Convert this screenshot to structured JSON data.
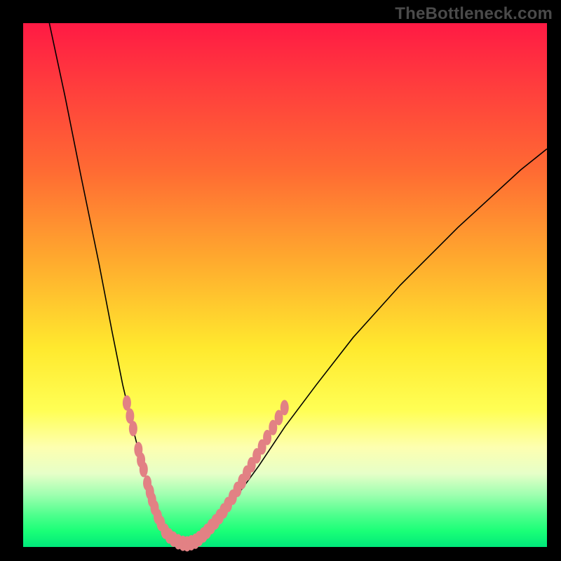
{
  "watermark": "TheBottleneck.com",
  "colors": {
    "frame": "#000000",
    "gradient_top": "#ff1a44",
    "gradient_bottom": "#00e87a",
    "curve": "#000000",
    "marker": "#e28184"
  },
  "chart_data": {
    "type": "line",
    "title": "",
    "xlabel": "",
    "ylabel": "",
    "xlim": [
      0,
      100
    ],
    "ylim": [
      0,
      100
    ],
    "annotations": [
      "TheBottleneck.com"
    ],
    "series": [
      {
        "name": "left-branch",
        "x": [
          5,
          8,
          11,
          14.5,
          17,
          19,
          21,
          22.5,
          23.7,
          24.5,
          25.5,
          27,
          29,
          31
        ],
        "y": [
          100,
          86,
          71,
          54,
          41,
          31,
          22.5,
          16.5,
          12,
          9,
          6,
          3,
          1,
          0
        ]
      },
      {
        "name": "right-branch",
        "x": [
          31,
          33,
          35.5,
          38,
          41,
          45,
          50,
          56,
          63,
          72,
          83,
          95,
          100
        ],
        "y": [
          0,
          1.2,
          3.2,
          6,
          10,
          15.5,
          23,
          31,
          40,
          50,
          61,
          72,
          76
        ]
      }
    ],
    "markers": {
      "name": "highlight-markers",
      "points": [
        {
          "x": 19.8,
          "y": 27.5
        },
        {
          "x": 20.4,
          "y": 25.0
        },
        {
          "x": 21.0,
          "y": 22.6
        },
        {
          "x": 22.0,
          "y": 18.6
        },
        {
          "x": 22.5,
          "y": 16.6
        },
        {
          "x": 23.0,
          "y": 14.8
        },
        {
          "x": 23.7,
          "y": 12.2
        },
        {
          "x": 24.2,
          "y": 10.5
        },
        {
          "x": 24.6,
          "y": 9.0
        },
        {
          "x": 25.1,
          "y": 7.5
        },
        {
          "x": 25.7,
          "y": 5.8
        },
        {
          "x": 26.3,
          "y": 4.5
        },
        {
          "x": 27.1,
          "y": 3.0
        },
        {
          "x": 27.9,
          "y": 2.1
        },
        {
          "x": 28.7,
          "y": 1.5
        },
        {
          "x": 29.6,
          "y": 1.0
        },
        {
          "x": 30.5,
          "y": 0.7
        },
        {
          "x": 31.3,
          "y": 0.6
        },
        {
          "x": 32.1,
          "y": 0.8
        },
        {
          "x": 32.9,
          "y": 1.1
        },
        {
          "x": 33.6,
          "y": 1.6
        },
        {
          "x": 34.4,
          "y": 2.3
        },
        {
          "x": 35.1,
          "y": 3.0
        },
        {
          "x": 35.9,
          "y": 3.9
        },
        {
          "x": 36.7,
          "y": 4.8
        },
        {
          "x": 37.5,
          "y": 5.8
        },
        {
          "x": 38.3,
          "y": 6.9
        },
        {
          "x": 39.1,
          "y": 8.1
        },
        {
          "x": 40.0,
          "y": 9.5
        },
        {
          "x": 40.9,
          "y": 11.0
        },
        {
          "x": 41.8,
          "y": 12.5
        },
        {
          "x": 42.7,
          "y": 14.1
        },
        {
          "x": 43.6,
          "y": 15.7
        },
        {
          "x": 44.6,
          "y": 17.4
        },
        {
          "x": 45.6,
          "y": 19.1
        },
        {
          "x": 46.6,
          "y": 20.9
        },
        {
          "x": 47.7,
          "y": 22.8
        },
        {
          "x": 48.8,
          "y": 24.7
        },
        {
          "x": 49.9,
          "y": 26.6
        }
      ]
    }
  }
}
